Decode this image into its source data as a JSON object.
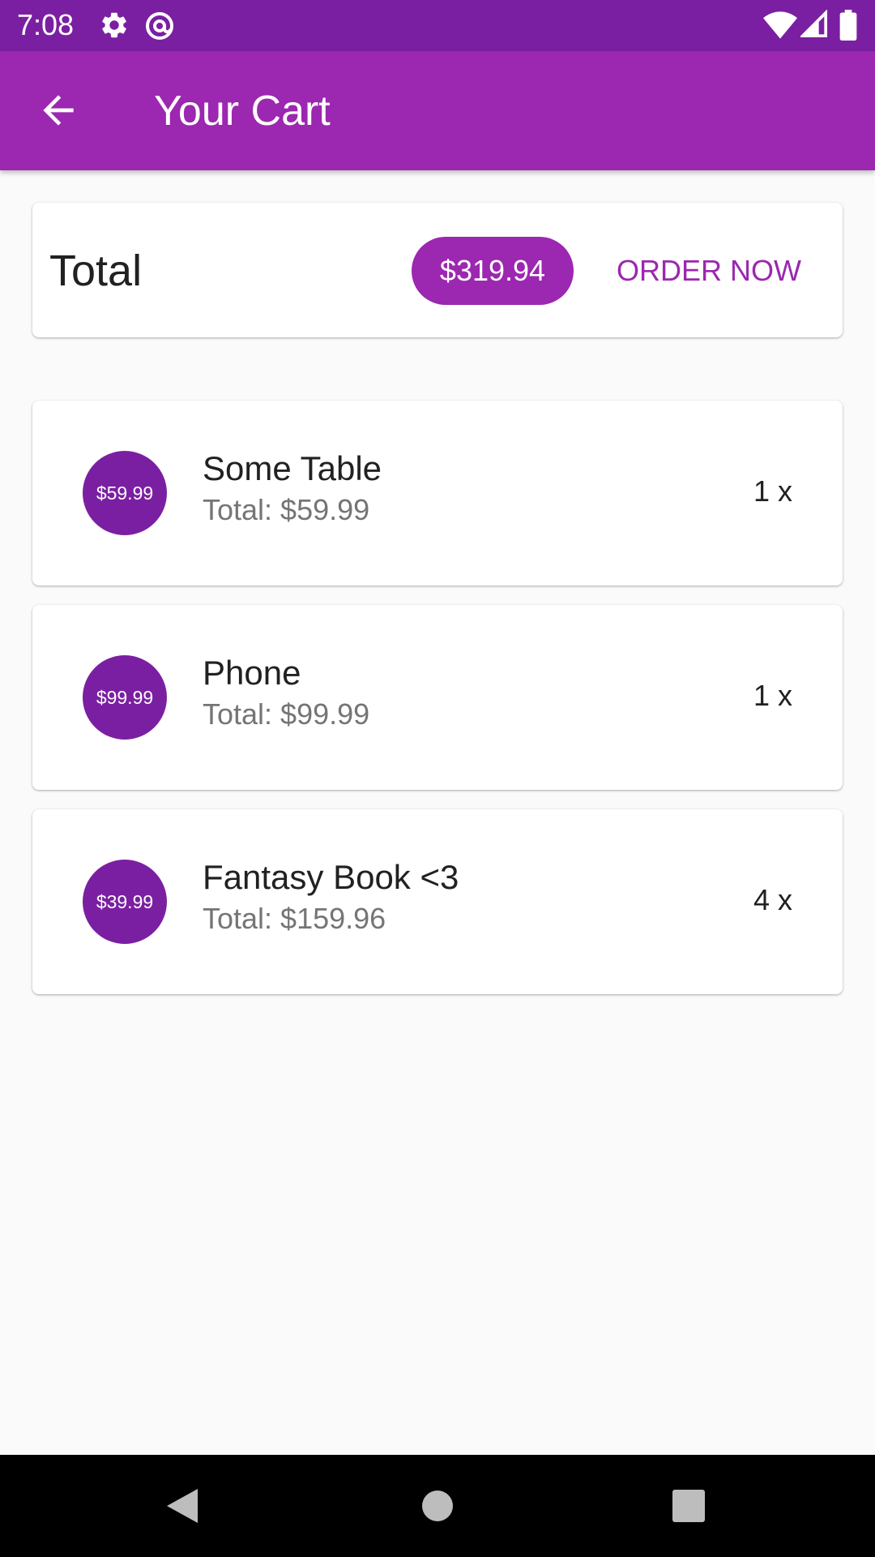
{
  "status_bar": {
    "time": "7:08",
    "left_icons": [
      "settings-icon",
      "at-sign-icon"
    ],
    "right_icons": [
      "wifi-icon",
      "cell-signal-icon",
      "battery-icon"
    ]
  },
  "app_bar": {
    "back_icon": "arrow-back-icon",
    "title": "Your Cart"
  },
  "summary": {
    "label": "Total",
    "amount": "$319.94",
    "order_button": "ORDER NOW"
  },
  "items": [
    {
      "price": "$59.99",
      "name": "Some Table",
      "total": "Total: $59.99",
      "quantity": "1 x"
    },
    {
      "price": "$99.99",
      "name": "Phone",
      "total": "Total: $99.99",
      "quantity": "1 x"
    },
    {
      "price": "$39.99",
      "name": "Fantasy Book <3",
      "total": "Total: $159.96",
      "quantity": "4 x"
    }
  ],
  "nav_bar": {
    "icons": [
      "back-triangle-icon",
      "home-circle-icon",
      "recents-square-icon"
    ]
  },
  "colors": {
    "primary": "#9c27b0",
    "primary_dark": "#7b1fa2",
    "background": "#fafafa"
  }
}
